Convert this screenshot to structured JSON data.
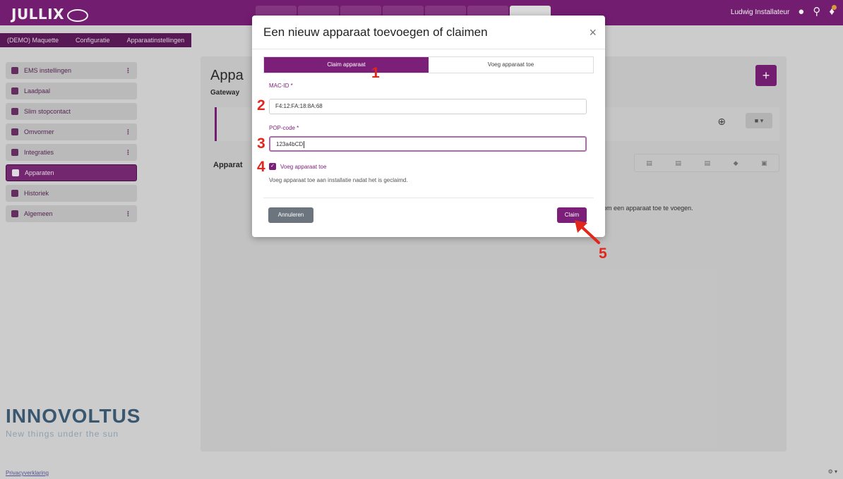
{
  "header": {
    "logo_text": "JULLIX",
    "user_name": "Ludwig Installateur"
  },
  "breadcrumb": [
    {
      "label": "(DEMO) Maquette"
    },
    {
      "label": "Configuratie"
    },
    {
      "label": "Apparaatinstellingen"
    }
  ],
  "sidebar": {
    "items": [
      {
        "label": "EMS instellingen"
      },
      {
        "label": "Laadpaal"
      },
      {
        "label": "Slim stopcontact"
      },
      {
        "label": "Omvormer"
      },
      {
        "label": "Integraties"
      },
      {
        "label": "Apparaten"
      },
      {
        "label": "Historiek"
      },
      {
        "label": "Algemeen"
      }
    ]
  },
  "brand": {
    "name": "INNOVOLTUS",
    "tagline": "New things under the sun"
  },
  "content": {
    "page_title": "Appa",
    "gateway_label": "Gateway",
    "apparaten_label": "Apparat",
    "empty_text": "om een apparaat toe te voegen."
  },
  "footer": {
    "link": "Privacyverklaring"
  },
  "modal": {
    "title": "Een nieuw apparaat toevoegen of claimen",
    "tabs": [
      {
        "label": "Claim apparaat",
        "active": true
      },
      {
        "label": "Voeg apparaat toe",
        "active": false
      }
    ],
    "mac_label": "MAC-ID *",
    "mac_value": "F4:12:FA:18:8A:68",
    "pop_label": "POP-code *",
    "pop_value": "123a4bCD",
    "checkbox_label": "Voeg apparaat toe",
    "help_text": "Voeg apparaat toe aan installatie nadat het is geclaimd.",
    "cancel_label": "Annuleren",
    "claim_label": "Claim"
  },
  "annotations": [
    "1",
    "2",
    "3",
    "4",
    "5"
  ],
  "colors": {
    "accent": "#7b1f78",
    "annotation": "#e1261c"
  }
}
